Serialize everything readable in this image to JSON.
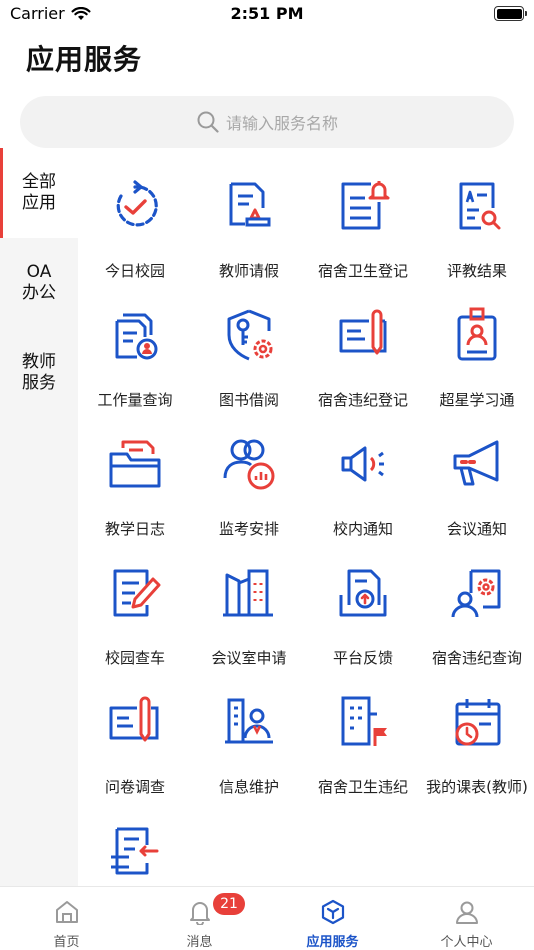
{
  "status_bar": {
    "carrier": "Carrier",
    "time": "2:51 PM"
  },
  "page": {
    "title": "应用服务"
  },
  "search": {
    "placeholder": "请输入服务名称"
  },
  "sidebar": {
    "items": [
      {
        "label": "全部\n应用",
        "active": true
      },
      {
        "label": "OA\n办公",
        "active": false
      },
      {
        "label": "教师\n服务",
        "active": false
      }
    ]
  },
  "services": [
    {
      "label": "今日校园",
      "icon": "clock-check-icon"
    },
    {
      "label": "教师请假",
      "icon": "document-stamp-icon"
    },
    {
      "label": "宿舍卫生登记",
      "icon": "document-bell-icon"
    },
    {
      "label": "评教结果",
      "icon": "document-search-icon"
    },
    {
      "label": "工作量查询",
      "icon": "files-user-icon"
    },
    {
      "label": "图书借阅",
      "icon": "key-shield-gear-icon"
    },
    {
      "label": "宿舍违纪登记",
      "icon": "document-pen-icon"
    },
    {
      "label": "超星学习通",
      "icon": "id-badge-icon"
    },
    {
      "label": "教学日志",
      "icon": "folder-icon"
    },
    {
      "label": "监考安排",
      "icon": "user-chart-icon"
    },
    {
      "label": "校内通知",
      "icon": "speaker-icon"
    },
    {
      "label": "会议通知",
      "icon": "megaphone-icon"
    },
    {
      "label": "校园查车",
      "icon": "document-edit-icon"
    },
    {
      "label": "会议室申请",
      "icon": "buildings-icon"
    },
    {
      "label": "平台反馈",
      "icon": "document-upload-icon"
    },
    {
      "label": "宿舍违纪查询",
      "icon": "user-gear-icon"
    },
    {
      "label": "问卷调查",
      "icon": "questionnaire-pen-icon"
    },
    {
      "label": "信息维护",
      "icon": "building-user-icon"
    },
    {
      "label": "宿舍卫生违纪",
      "icon": "building-flag-icon"
    },
    {
      "label": "我的课表(教师)",
      "icon": "calendar-clock-icon"
    },
    {
      "label": "",
      "icon": "document-swap-icon"
    }
  ],
  "tab_bar": {
    "items": [
      {
        "label": "首页",
        "icon": "home-icon"
      },
      {
        "label": "消息",
        "icon": "bell-icon",
        "badge": "21"
      },
      {
        "label": "应用服务",
        "icon": "cube-icon",
        "active": true
      },
      {
        "label": "个人中心",
        "icon": "person-icon"
      }
    ]
  },
  "colors": {
    "accent_blue": "#1c54c8",
    "accent_red": "#e8403a"
  }
}
